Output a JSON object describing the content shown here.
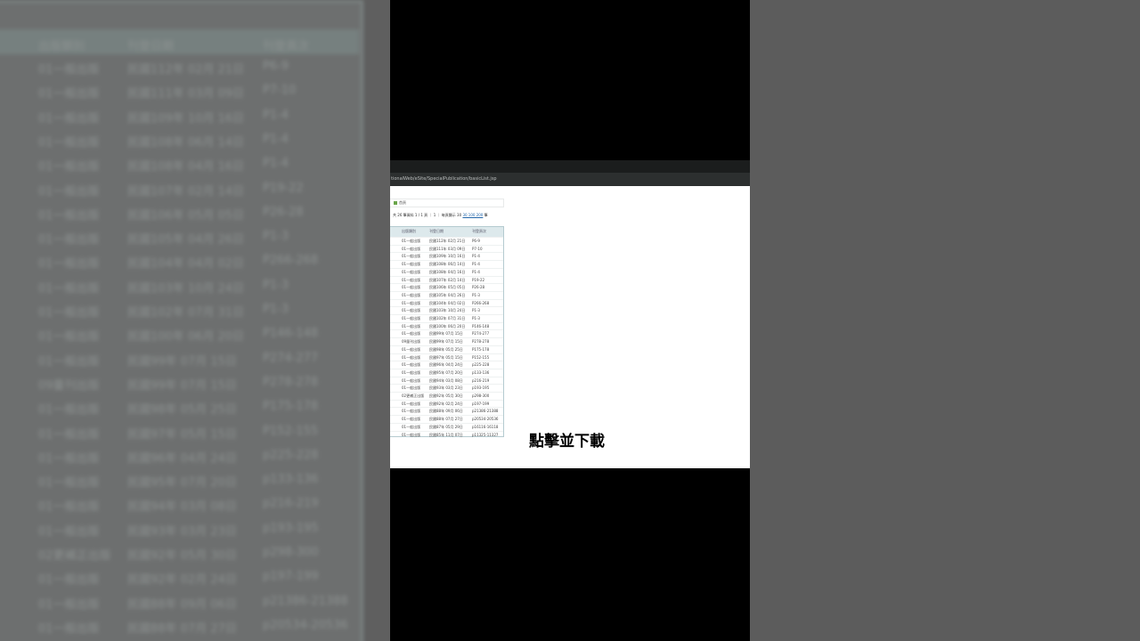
{
  "url": "tionalWeb/eSite/SpecialPublication/basicList.jsp",
  "nav": {
    "home_label": "首頁"
  },
  "pager": {
    "summary": "共 26 筆資料 1 / 1 頁 ｜ 1 ｜ 每頁顯示 30",
    "size_options": "30 100 200",
    "suffix": "筆"
  },
  "columns": [
    "",
    "出版類別",
    "刊登日期",
    "刊登頁次"
  ],
  "rows": [
    [
      "",
      "01一般出版",
      "民國112年 02月 21日",
      "P6-9"
    ],
    [
      "",
      "01一般出版",
      "民國111年 03月 09日",
      "P7-10"
    ],
    [
      "",
      "01一般出版",
      "民國109年 10月 16日",
      "P1-4"
    ],
    [
      "",
      "01一般出版",
      "民國108年 06月 14日",
      "P1-4"
    ],
    [
      "",
      "01一般出版",
      "民國108年 04月 16日",
      "P1-4"
    ],
    [
      "",
      "01一般出版",
      "民國107年 02月 14日",
      "P19-22"
    ],
    [
      "",
      "01一般出版",
      "民國106年 05月 05日",
      "P26-28"
    ],
    [
      "",
      "01一般出版",
      "民國105年 04月 26日",
      "P1-3"
    ],
    [
      "",
      "01一般出版",
      "民國104年 04月 02日",
      "P266-268"
    ],
    [
      "",
      "01一般出版",
      "民國103年 10月 24日",
      "P1-3"
    ],
    [
      "",
      "01一般出版",
      "民國102年 07月 31日",
      "P1-3"
    ],
    [
      "",
      "01一般出版",
      "民國100年 06月 20日",
      "P146-148"
    ],
    [
      "",
      "01一般出版",
      "民國99年 07月 15日",
      "P274-277"
    ],
    [
      "",
      "09量刊出版",
      "民國99年 07月 15日",
      "P278-278"
    ],
    [
      "",
      "01一般出版",
      "民國98年 05月 25日",
      "P175-178"
    ],
    [
      "",
      "01一般出版",
      "民國97年 05月 15日",
      "P152-155"
    ],
    [
      "",
      "01一般出版",
      "民國96年 04月 24日",
      "p225-228"
    ],
    [
      "",
      "01一般出版",
      "民國95年 07月 20日",
      "p133-136"
    ],
    [
      "",
      "01一般出版",
      "民國94年 03月 08日",
      "p216-219"
    ],
    [
      "",
      "01一般出版",
      "民國93年 03月 23日",
      "p193-195"
    ],
    [
      "",
      "02更補正出版",
      "民國92年 05月 30日",
      "p298-300"
    ],
    [
      "",
      "01一般出版",
      "民國92年 02月 24日",
      "p197-199"
    ],
    [
      "",
      "01一般出版",
      "民國88年 09月 06日",
      "p21386-21388"
    ],
    [
      "",
      "01一般出版",
      "民國88年 07月 27日",
      "p20534-20536"
    ],
    [
      "",
      "01一般出版",
      "民國87年 05月 29日",
      "p16116-16118"
    ],
    [
      "",
      "01一般出版",
      "民國85年 11月 07日",
      "p11325-11327"
    ]
  ],
  "caption": "點擊並下載"
}
